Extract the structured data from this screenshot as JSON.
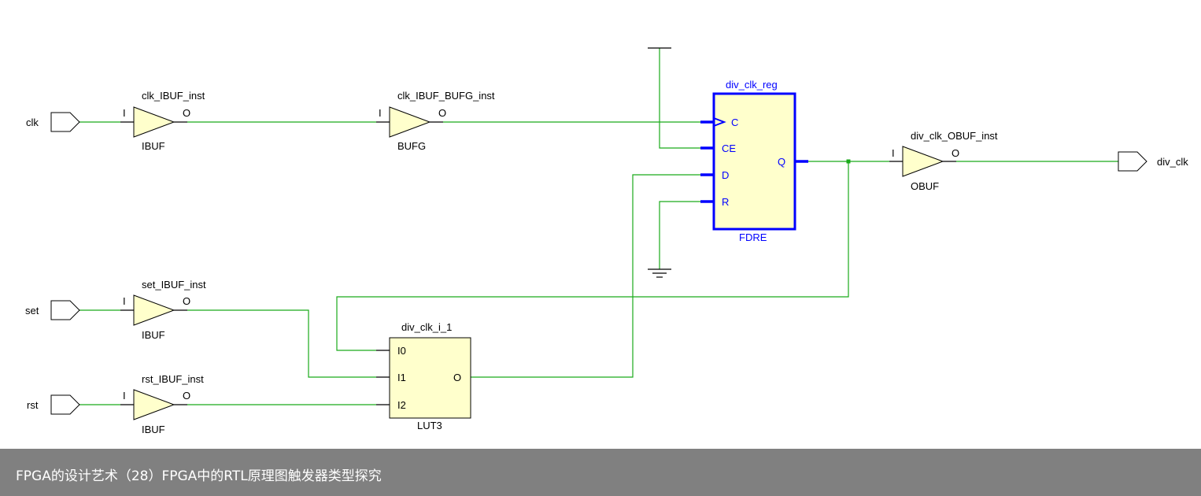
{
  "ports": {
    "clk": "clk",
    "set": "set",
    "rst": "rst",
    "div_clk": "div_clk"
  },
  "cells": {
    "clk_ibuf": {
      "name": "clk_IBUF_inst",
      "type": "IBUF",
      "in": "I",
      "out": "O"
    },
    "clk_bufg": {
      "name": "clk_IBUF_BUFG_inst",
      "type": "BUFG",
      "in": "I",
      "out": "O"
    },
    "set_ibuf": {
      "name": "set_IBUF_inst",
      "type": "IBUF",
      "in": "I",
      "out": "O"
    },
    "rst_ibuf": {
      "name": "rst_IBUF_inst",
      "type": "IBUF",
      "in": "I",
      "out": "O"
    },
    "obuf": {
      "name": "div_clk_OBUF_inst",
      "type": "OBUF",
      "in": "I",
      "out": "O"
    },
    "reg": {
      "name": "div_clk_reg",
      "type": "FDRE",
      "pins": {
        "c": "C",
        "ce": "CE",
        "d": "D",
        "r": "R",
        "q": "Q"
      }
    },
    "lut": {
      "name": "div_clk_i_1",
      "type": "LUT3",
      "pins": {
        "i0": "I0",
        "i1": "I1",
        "i2": "I2",
        "o": "O"
      }
    }
  },
  "colors": {
    "wire": "#1aaa1a",
    "selected": "#0000ff",
    "cell_fill": "#ffffcc",
    "footer": "#808080"
  },
  "footer": {
    "caption": "FPGA的设计艺术（28）FPGA中的RTL原理图触发器类型探究"
  }
}
